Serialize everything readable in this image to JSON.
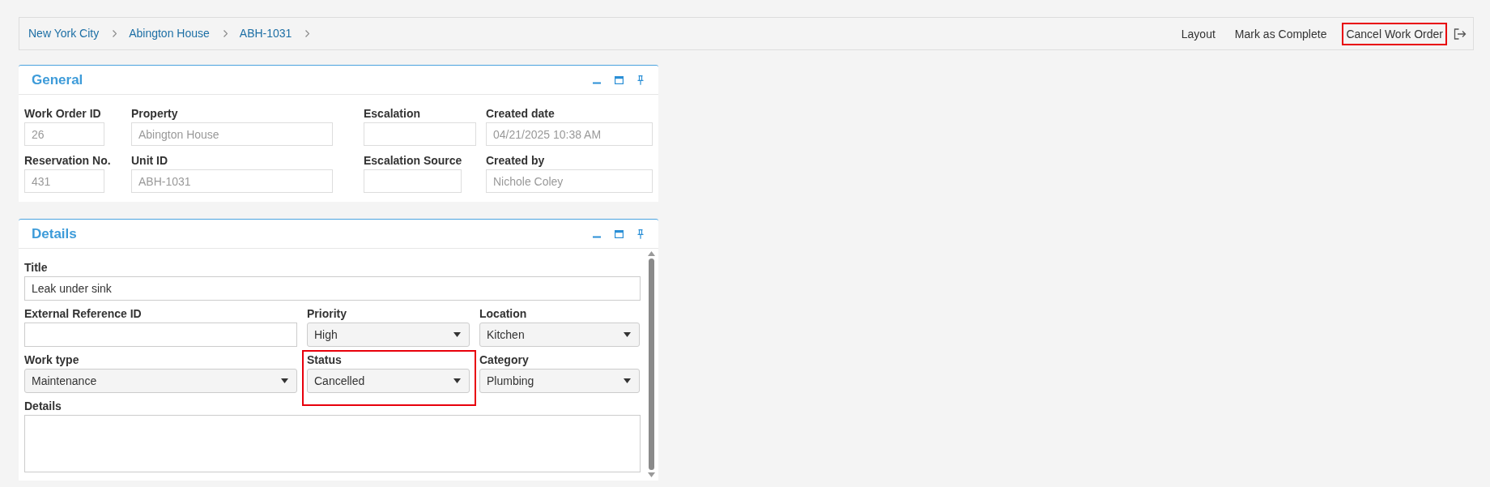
{
  "breadcrumb": [
    {
      "label": "New York City"
    },
    {
      "label": "Abington House"
    },
    {
      "label": "ABH-1031"
    }
  ],
  "toolbar": [
    {
      "label": "Layout",
      "highlighted": false
    },
    {
      "label": "Mark as Complete",
      "highlighted": false
    },
    {
      "label": "Cancel Work Order",
      "highlighted": true
    }
  ],
  "general": {
    "title": "General",
    "rows": [
      [
        {
          "label": "Work Order ID",
          "value": "26",
          "disabled": true
        },
        {
          "label": "Property",
          "value": "Abington House",
          "disabled": true
        },
        {
          "label": "Escalation",
          "disabled": true
        },
        {
          "label": "Created date",
          "value": "04/21/2025 10:38 AM",
          "disabled": true
        }
      ],
      [
        {
          "label": "Reservation No.",
          "value": "431",
          "disabled": true
        },
        {
          "label": "Unit ID",
          "value": "ABH-1031",
          "disabled": true
        },
        {
          "label": "Escalation Source",
          "disabled": true
        },
        {
          "label": "Created by",
          "value": "Nichole Coley",
          "disabled": true
        }
      ]
    ]
  },
  "details": {
    "title": "Details",
    "rows": [
      [
        {
          "kind": "text",
          "label": "Title",
          "value": "Leak under sink",
          "highlighted": false
        }
      ],
      [
        {
          "kind": "text",
          "label": "External Reference ID",
          "highlighted": false
        },
        {
          "kind": "select",
          "label": "Priority",
          "value": "High",
          "highlighted": false
        },
        {
          "kind": "select",
          "label": "Location",
          "value": "Kitchen",
          "highlighted": false
        }
      ],
      [
        {
          "kind": "select",
          "label": "Work type",
          "value": "Maintenance",
          "highlighted": false
        },
        {
          "kind": "select",
          "label": "Status",
          "value": "Cancelled",
          "highlighted": true
        },
        {
          "kind": "select",
          "label": "Category",
          "value": "Plumbing",
          "highlighted": false
        }
      ],
      [
        {
          "kind": "textarea",
          "label": "Details",
          "highlighted": false
        }
      ]
    ]
  }
}
